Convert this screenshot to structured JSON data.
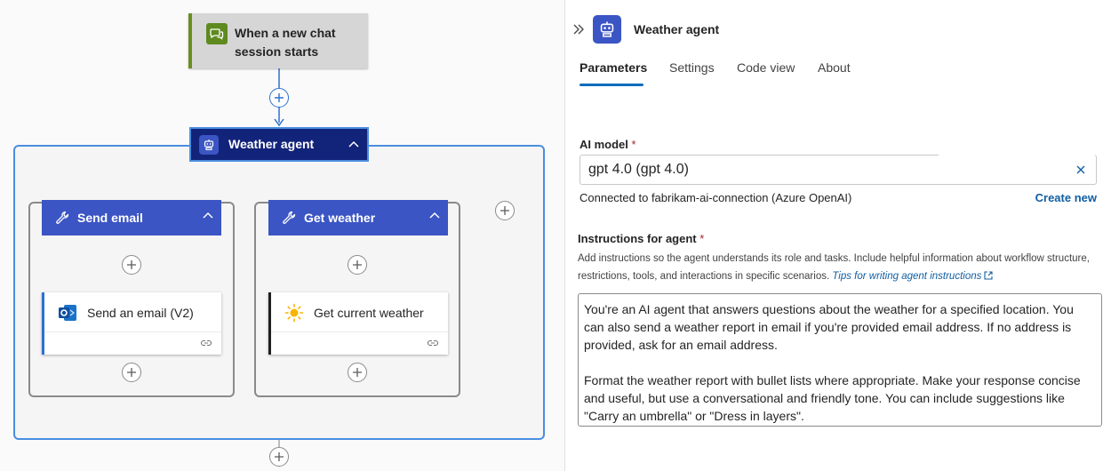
{
  "canvas": {
    "trigger": {
      "title": "When a new chat session starts",
      "icon": "chat-bubbles-icon",
      "accent": "#6b8e23"
    },
    "agent": {
      "title": "Weather agent",
      "icon": "robot-icon",
      "color": "#12237a",
      "border": "#4a8ee0"
    },
    "tools": [
      {
        "title": "Send email",
        "icon": "wrench-icon",
        "action": {
          "title": "Send an email (V2)",
          "icon": "outlook-icon"
        }
      },
      {
        "title": "Get weather",
        "icon": "wrench-icon",
        "action": {
          "title": "Get current weather",
          "icon": "sun-icon"
        }
      }
    ],
    "tool_color": "#3b55c4"
  },
  "panel": {
    "title": "Weather agent",
    "tabs": [
      "Parameters",
      "Settings",
      "Code view",
      "About"
    ],
    "active_tab": "Parameters",
    "ai_model": {
      "label": "AI model",
      "required_mark": "*",
      "value": "gpt 4.0 (gpt 4.0)",
      "connection_text": "Connected to fabrikam-ai-connection (Azure OpenAI)",
      "create_new": "Create new"
    },
    "instructions": {
      "label": "Instructions for agent",
      "required_mark": "*",
      "helper": "Add instructions so the agent understands its role and tasks. Include helpful information about workflow structure, restrictions, tools, and interactions in specific scenarios.",
      "tips_link": "Tips for writing agent instructions",
      "paragraph1": "You're an AI agent that answers questions about the weather for a specified location. You can also send a weather report in email if you're provided email address. If no address is provided, ask for an email address.",
      "paragraph2": "Format the weather report with bullet lists where appropriate. Make your response concise and useful, but use a conversational and friendly tone. You can include suggestions like \"Carry an umbrella\" or \"Dress in layers\"."
    },
    "accent": "#0f6cbd"
  }
}
